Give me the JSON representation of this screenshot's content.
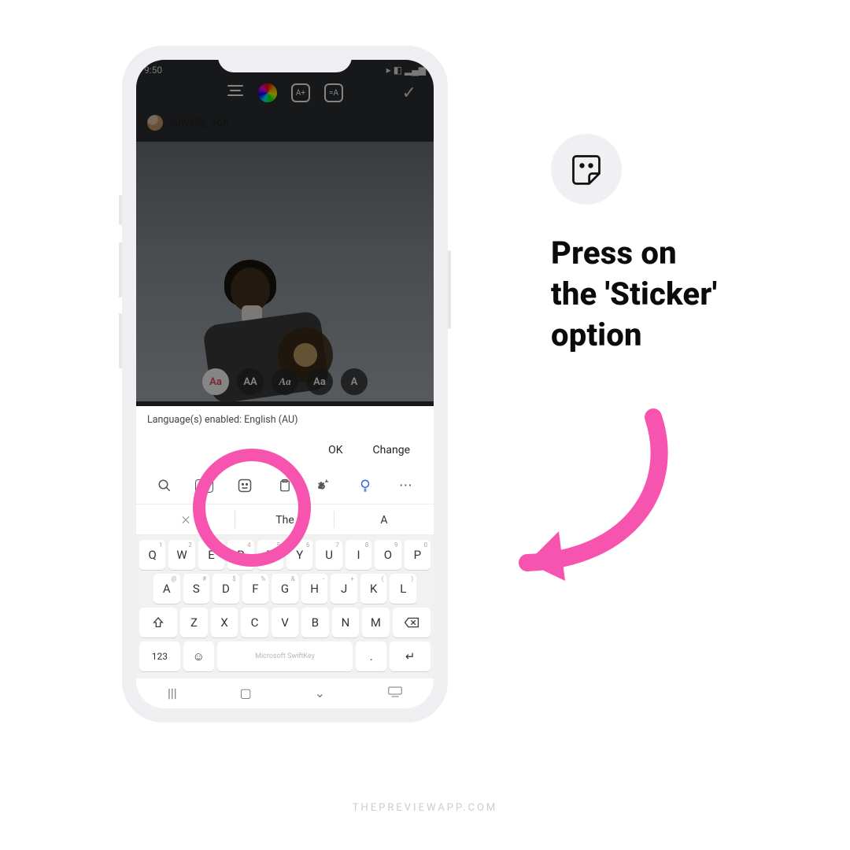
{
  "status": {
    "time": "9:50"
  },
  "mention": {
    "username": "suwelly_soh"
  },
  "font_picker": {
    "opt1": "Aa",
    "opt2": "AA",
    "opt3": "Aa",
    "opt4": "Aa",
    "opt5": "A"
  },
  "lang_strip": "Language(s) enabled: English (AU)",
  "actions": {
    "ok": "OK",
    "change": "Change"
  },
  "toolbar": {
    "gif": "GIF"
  },
  "suggestions": {
    "s1": "⨉",
    "s2": "The",
    "s3": "A"
  },
  "keys": {
    "r1": [
      "Q",
      "W",
      "E",
      "R",
      "T",
      "Y",
      "U",
      "I",
      "O",
      "P"
    ],
    "n1": [
      "1",
      "2",
      "3",
      "4",
      "5",
      "6",
      "7",
      "8",
      "9",
      "0"
    ],
    "r2": [
      "A",
      "S",
      "D",
      "F",
      "G",
      "H",
      "J",
      "K",
      "L"
    ],
    "n2": [
      "@",
      "#",
      "$",
      "%",
      "&",
      "-",
      "+",
      "(",
      ")"
    ],
    "r3": [
      "Z",
      "X",
      "C",
      "V",
      "B",
      "N",
      "M"
    ],
    "numbers": "123",
    "space": "Microsoft SwiftKey"
  },
  "callout": {
    "line1": "Press on",
    "line2": "the 'Sticker'",
    "line3": "option"
  },
  "nav": {
    "recent": "|||",
    "home": "▢",
    "back": "⌄"
  },
  "watermark": "THEPREVIEWAPP.COM"
}
